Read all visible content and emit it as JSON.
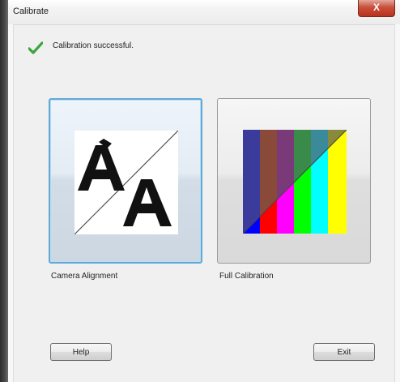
{
  "window": {
    "title": "Calibrate",
    "close_label": "X"
  },
  "status": {
    "icon": "checkmark-icon",
    "message": "Calibration successful."
  },
  "options": [
    {
      "label": "Camera Alignment",
      "icon": "camera-alignment-icon",
      "selected": true
    },
    {
      "label": "Full Calibration",
      "icon": "full-calibration-icon",
      "selected": false
    }
  ],
  "buttons": {
    "help": "Help",
    "exit": "Exit"
  },
  "colors": {
    "selection_border": "#62a9d8",
    "check": "#3aa53a",
    "close_button": "#c9503a",
    "bars": [
      "#3b3b9c",
      "#8a4a3a",
      "#7a3a7a",
      "#3a8a4a",
      "#3a8a9a",
      "#8a8a3a"
    ],
    "bars_bright": [
      "#0000ff",
      "#ff0000",
      "#ff00ff",
      "#00ff00",
      "#00ffff",
      "#ffff00"
    ]
  }
}
